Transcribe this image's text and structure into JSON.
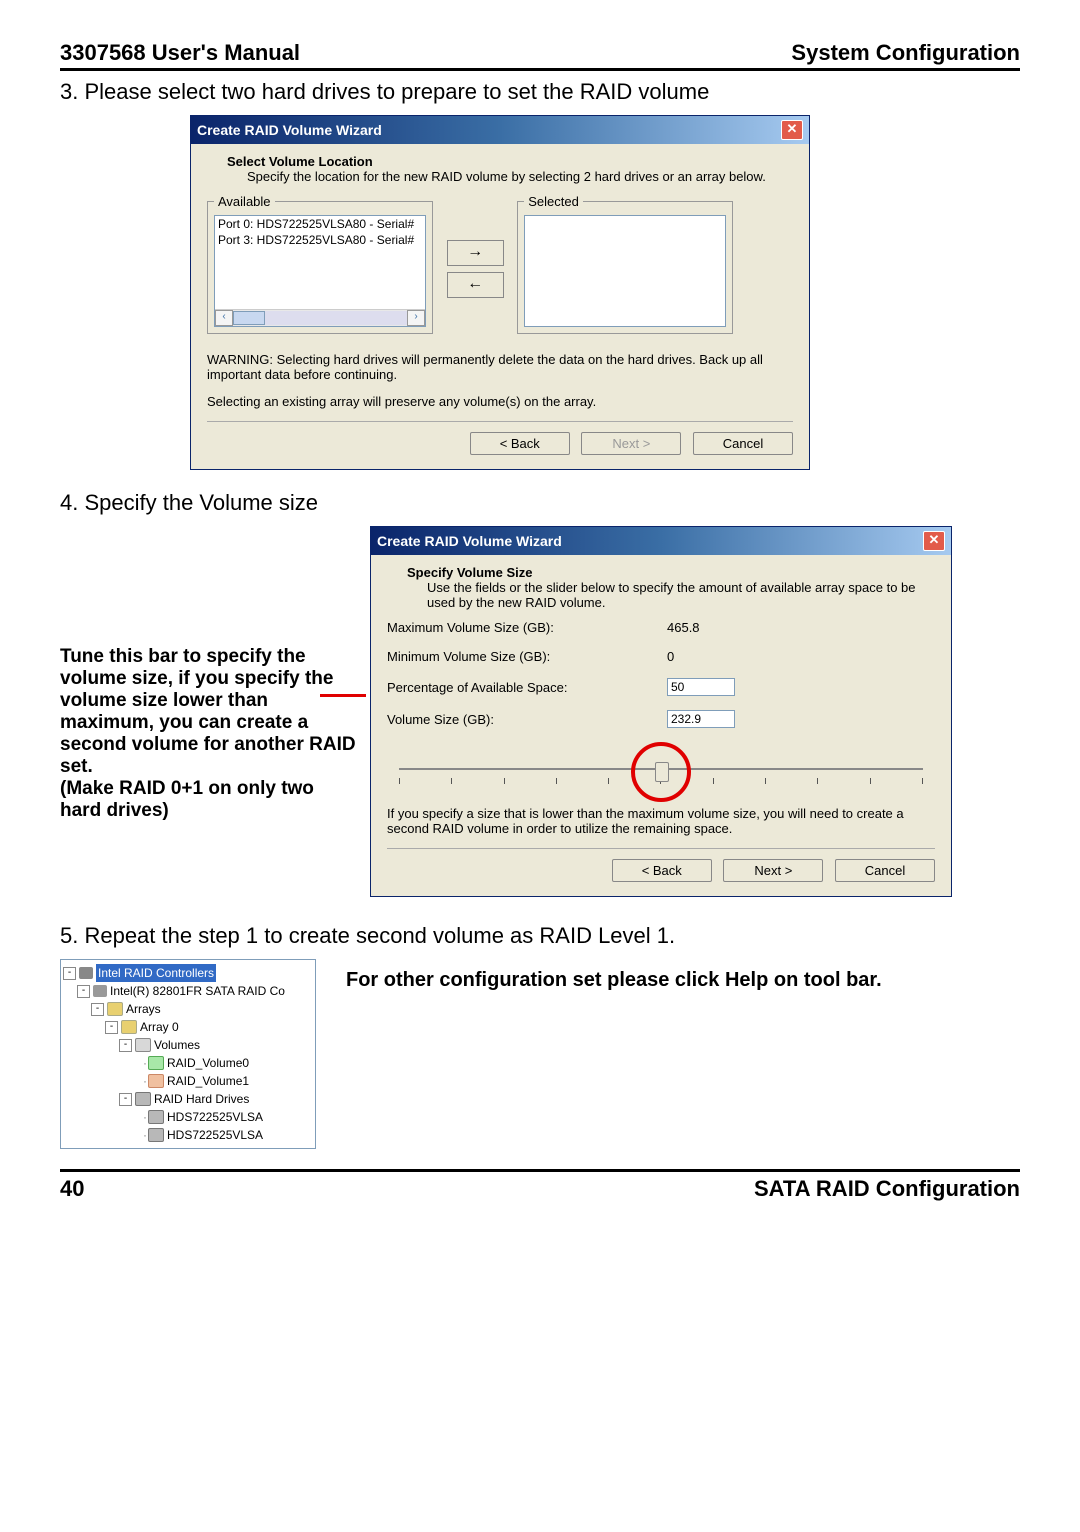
{
  "header": {
    "left": "3307568 User's Manual",
    "right": "System Configuration"
  },
  "step3": "3. Please select two hard drives to prepare to set the RAID volume",
  "wizard1": {
    "title": "Create RAID Volume Wizard",
    "subtitle": "Select Volume Location",
    "subdesc": "Specify the location for the new RAID volume by selecting 2 hard drives or an array below.",
    "available_legend": "Available",
    "selected_legend": "Selected",
    "available_items": [
      "Port 0: HDS722525VLSA80 - Serial#",
      "Port 3: HDS722525VLSA80 - Serial#"
    ],
    "warning": "WARNING: Selecting hard drives will permanently delete the data on the hard drives. Back up all important data before continuing.",
    "note2": "Selecting an existing array will preserve any volume(s) on the array.",
    "back": "< Back",
    "next": "Next >",
    "cancel": "Cancel"
  },
  "step4": "4. Specify the Volume size",
  "left_note": "Tune this bar to specify the volume size, if you specify the volume size lower than maximum, you can create a second volume for another RAID set.\n(Make RAID 0+1 on only two hard drives)",
  "wizard2": {
    "title": "Create RAID Volume Wizard",
    "subtitle": "Specify Volume Size",
    "subdesc": "Use the fields or the slider below to specify the amount of available array space to be used by the new RAID volume.",
    "max_label": "Maximum Volume Size (GB):",
    "max_val": "465.8",
    "min_label": "Minimum Volume Size (GB):",
    "min_val": "0",
    "pct_label": "Percentage of Available Space:",
    "pct_val": "50",
    "size_label": "Volume Size (GB):",
    "size_val": "232.9",
    "slider_note": "If you specify a size that is lower than the maximum volume size, you will need to create a second RAID volume in order to utilize the remaining space.",
    "back": "< Back",
    "next": "Next >",
    "cancel": "Cancel"
  },
  "step5": "5. Repeat the step 1 to create second volume as RAID Level 1.",
  "help_note": "For other configuration set please click Help on tool bar.",
  "tree": {
    "root": "Intel RAID Controllers",
    "chip": "Intel(R) 82801FR SATA RAID Co",
    "arrays": "Arrays",
    "array0": "Array 0",
    "volumes": "Volumes",
    "vol0": "RAID_Volume0",
    "vol1": "RAID_Volume1",
    "hdd_folder": "RAID Hard Drives",
    "hdd0": "HDS722525VLSA",
    "hdd1": "HDS722525VLSA"
  },
  "footer": {
    "page": "40",
    "section": "SATA  RAID  Configuration"
  }
}
